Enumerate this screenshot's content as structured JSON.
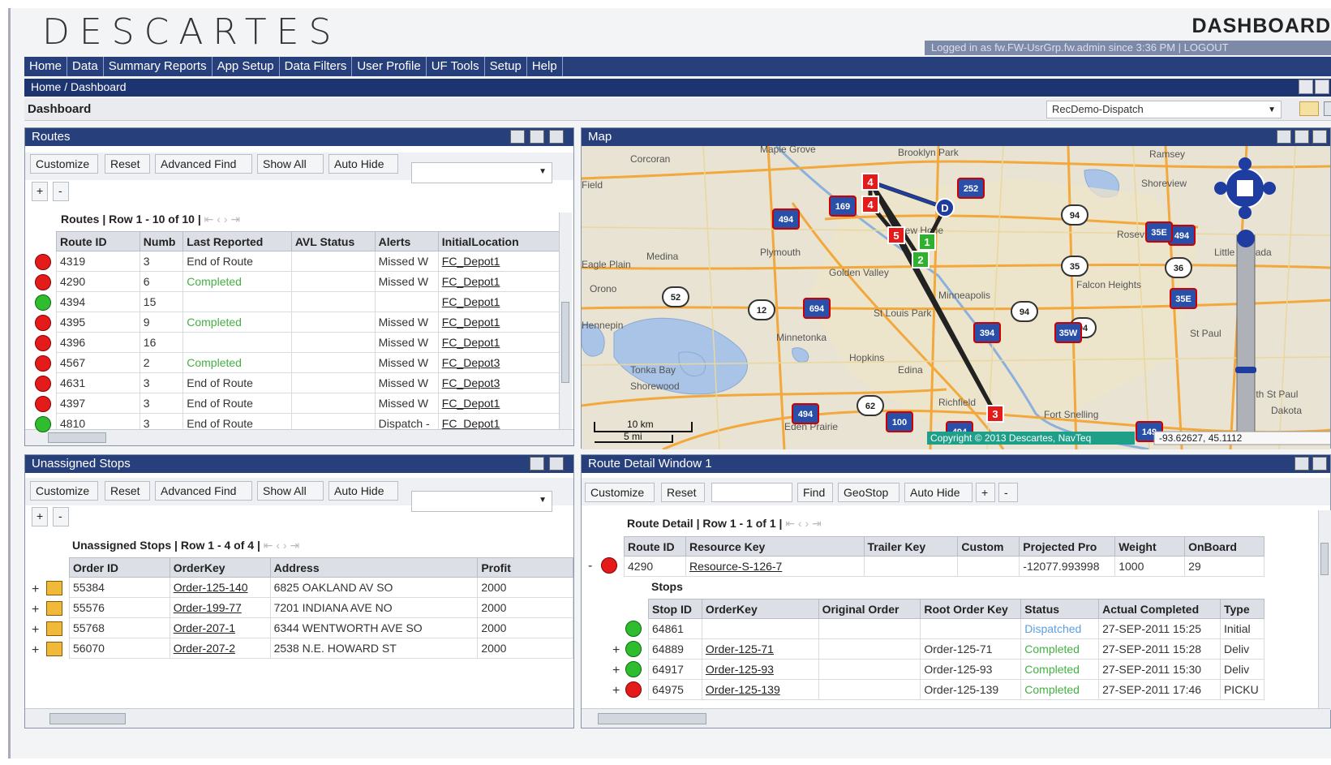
{
  "app": {
    "logo": "DESCARTES",
    "page_title": "DASHBOARD",
    "user_bar": "Logged in as fw.FW-UsrGrp.fw.admin since 3:36 PM | LOGOUT"
  },
  "menu": [
    "Home",
    "Data",
    "Summary Reports",
    "App Setup",
    "Data Filters",
    "User Profile",
    "UF Tools",
    "Setup",
    "Help"
  ],
  "breadcrumb": "Home / Dashboard",
  "dashboard": {
    "label": "Dashboard",
    "selected": "RecDemo-Dispatch"
  },
  "routes": {
    "title": "Routes",
    "buttons": [
      "Customize",
      "Reset",
      "Advanced Find",
      "Show All",
      "Auto Hide"
    ],
    "grid_title": "Routes | Row 1 - 10 of 10 |",
    "headers": [
      "Route ID",
      "Numb",
      "Last Reported",
      "AVL Status",
      "Alerts",
      "InitialLocation"
    ],
    "rows": [
      {
        "icon": "red",
        "id": "4319",
        "num": "3",
        "last": "End of Route",
        "last_color": "",
        "avl": "",
        "alerts": "Missed W",
        "loc": "FC_Depot1"
      },
      {
        "icon": "red",
        "id": "4290",
        "num": "6",
        "last": "Completed",
        "last_color": "green",
        "avl": "",
        "alerts": "Missed W",
        "loc": "FC_Depot1"
      },
      {
        "icon": "green",
        "id": "4394",
        "num": "15",
        "last": "",
        "last_color": "",
        "avl": "",
        "alerts": "",
        "loc": "FC_Depot1"
      },
      {
        "icon": "red",
        "id": "4395",
        "num": "9",
        "last": "Completed",
        "last_color": "green",
        "avl": "",
        "alerts": "Missed W",
        "loc": "FC_Depot1"
      },
      {
        "icon": "red",
        "id": "4396",
        "num": "16",
        "last": "",
        "last_color": "",
        "avl": "",
        "alerts": "Missed W",
        "loc": "FC_Depot1"
      },
      {
        "icon": "red",
        "id": "4567",
        "num": "2",
        "last": "Completed",
        "last_color": "green",
        "avl": "",
        "alerts": "Missed W",
        "loc": "FC_Depot3"
      },
      {
        "icon": "red",
        "id": "4631",
        "num": "3",
        "last": "End of Route",
        "last_color": "",
        "avl": "",
        "alerts": "Missed W",
        "loc": "FC_Depot3"
      },
      {
        "icon": "red",
        "id": "4397",
        "num": "3",
        "last": "End of Route",
        "last_color": "",
        "avl": "",
        "alerts": "Missed W",
        "loc": "FC_Depot1"
      },
      {
        "icon": "green",
        "id": "4810",
        "num": "3",
        "last": "End of Route",
        "last_color": "",
        "avl": "",
        "alerts": "Dispatch -",
        "loc": "FC_Depot1"
      }
    ]
  },
  "map": {
    "title": "Map",
    "copyright": "Copyright © 2013 Descartes, NavTeq",
    "coords": "-93.62627, 45.1112",
    "scale_km": "10 km",
    "scale_mi": "5 mi",
    "labels": [
      "Maple Grove",
      "Brooklyn Park",
      "Corcoran",
      "Ramsey",
      "Shoreview",
      "Medina",
      "Plymouth",
      "Golden Valley",
      "Roseville",
      "Falcon Heights",
      "Little Canada",
      "Orono",
      "St Louis Park",
      "Minnetonka",
      "Hopkins",
      "Edina",
      "Tonka Bay",
      "Shorewood",
      "Richfield",
      "Fort Snelling",
      "Eden Prairie",
      "South St Paul",
      "Dakota",
      "St Paul",
      "Minneapolis",
      "New Hope",
      "Eagle Plain",
      "Hennepin",
      "Field"
    ],
    "shields": [
      "169",
      "252",
      "494",
      "94",
      "494",
      "35",
      "36",
      "694",
      "394",
      "94",
      "94",
      "35E",
      "52",
      "12",
      "62",
      "100",
      "494",
      "494",
      "149",
      "35E",
      "35W"
    ],
    "markers": [
      "4",
      "4",
      "5",
      "3",
      "D",
      "1",
      "2"
    ]
  },
  "unassigned": {
    "title": "Unassigned Stops",
    "buttons": [
      "Customize",
      "Reset",
      "Advanced Find",
      "Show All",
      "Auto Hide"
    ],
    "grid_title": "Unassigned Stops | Row 1 - 4 of 4 |",
    "headers": [
      "Order ID",
      "OrderKey",
      "Address",
      "Profit"
    ],
    "rows": [
      {
        "id": "55384",
        "key": "Order-125-140",
        "addr": "6825 OAKLAND AV SO",
        "profit": "2000"
      },
      {
        "id": "55576",
        "key": "Order-199-77",
        "addr": "7201 INDIANA AVE NO",
        "profit": "2000"
      },
      {
        "id": "55768",
        "key": "Order-207-1",
        "addr": "6344 WENTWORTH AVE SO",
        "profit": "2000"
      },
      {
        "id": "56070",
        "key": "Order-207-2",
        "addr": "2538 N.E. HOWARD ST",
        "profit": "2000"
      }
    ]
  },
  "detail": {
    "title": "Route Detail Window 1",
    "buttons": [
      "Customize",
      "Reset",
      "Find",
      "GeoStop",
      "Auto Hide"
    ],
    "grid_title": "Route Detail | Row 1 - 1 of 1 |",
    "headers": [
      "Route ID",
      "Resource Key",
      "Trailer Key",
      "Custom",
      "Projected Pro",
      "Weight",
      "OnBoard"
    ],
    "row": {
      "id": "4290",
      "res": "Resource-S-126-7",
      "trailer": "",
      "custom": "",
      "proj": "-12077.993998",
      "weight": "1000",
      "onboard": "29"
    },
    "stops_label": "Stops",
    "stop_headers": [
      "Stop ID",
      "OrderKey",
      "Original Order",
      "Root Order Key",
      "Status",
      "Actual Completed",
      "Type"
    ],
    "stops": [
      {
        "icon": "green",
        "id": "64861",
        "key": "",
        "orig": "",
        "root": "",
        "status": "Dispatched",
        "status_color": "cyan",
        "done": "27-SEP-2011 15:25",
        "type": "Initial"
      },
      {
        "icon": "green",
        "id": "64889",
        "key": "Order-125-71",
        "orig": "",
        "root": "Order-125-71",
        "status": "Completed",
        "status_color": "green",
        "done": "27-SEP-2011 15:28",
        "type": "Deliv"
      },
      {
        "icon": "green",
        "id": "64917",
        "key": "Order-125-93",
        "orig": "",
        "root": "Order-125-93",
        "status": "Completed",
        "status_color": "green",
        "done": "27-SEP-2011 15:30",
        "type": "Deliv"
      },
      {
        "icon": "red",
        "id": "64975",
        "key": "Order-125-139",
        "orig": "",
        "root": "Order-125-139",
        "status": "Completed",
        "status_color": "green",
        "done": "27-SEP-2011 17:46",
        "type": "PICKU"
      }
    ]
  }
}
